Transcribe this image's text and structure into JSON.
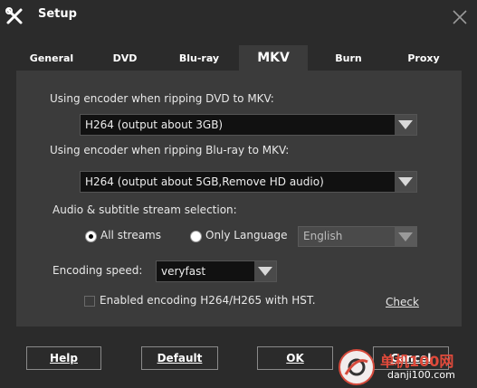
{
  "window": {
    "title": "Setup"
  },
  "tabs": [
    {
      "label": "General"
    },
    {
      "label": "DVD"
    },
    {
      "label": "Blu-ray"
    },
    {
      "label": "MKV",
      "active": true
    },
    {
      "label": "Burn"
    },
    {
      "label": "Proxy"
    }
  ],
  "dvd_encoder": {
    "label": "Using encoder when ripping DVD to MKV:",
    "value": "H264 (output about 3GB)"
  },
  "bluray_encoder": {
    "label": "Using encoder when ripping Blu-ray to MKV:",
    "value": "H264 (output about 5GB,Remove HD audio)"
  },
  "stream_selection": {
    "label": "Audio & subtitle stream selection:",
    "all_streams": "All streams",
    "only_language": "Only Language",
    "selected": "all_streams",
    "language_value": "English"
  },
  "encoding_speed": {
    "label": "Encoding speed:",
    "value": "veryfast"
  },
  "hst": {
    "label": "Enabled encoding H264/H265 with HST.",
    "checked": false,
    "check_link": "Check"
  },
  "buttons": {
    "help": "Help",
    "default": "Default",
    "ok": "OK",
    "cancel": "Cancel"
  },
  "watermark": {
    "site_name": "单机100网",
    "url": "danji100.com"
  },
  "colors": {
    "background": "#2b2b2b",
    "panel": "#3b3b3b",
    "field": "#111111",
    "watermark_red": "#e04a3b"
  }
}
